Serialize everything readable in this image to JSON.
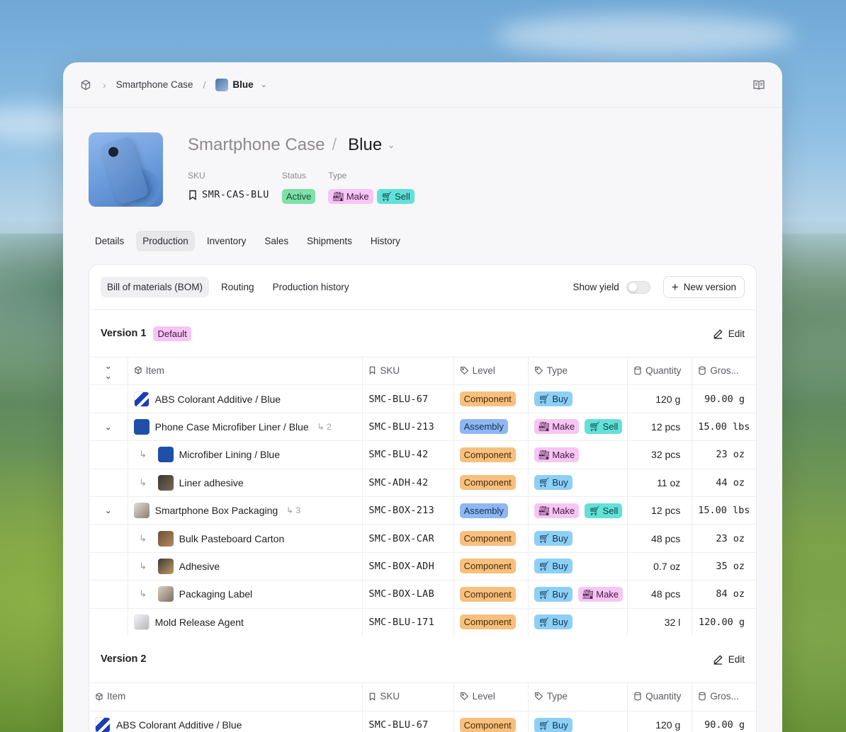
{
  "breadcrumb": {
    "parent": "Smartphone Case",
    "current": "Blue"
  },
  "product": {
    "name": "Smartphone Case",
    "variant": "Blue",
    "sku_label": "SKU",
    "sku": "SMR-CAS-BLU",
    "status_label": "Status",
    "status": "Active",
    "type_label": "Type",
    "types": [
      "Make",
      "Sell"
    ]
  },
  "tabs": [
    "Details",
    "Production",
    "Inventory",
    "Sales",
    "Shipments",
    "History"
  ],
  "active_tab": "Production",
  "subtabs": [
    "Bill of materials (BOM)",
    "Routing",
    "Production history"
  ],
  "show_yield_label": "Show yield",
  "new_version_label": "New version",
  "edit_label": "Edit",
  "columns": [
    "Item",
    "SKU",
    "Level",
    "Type",
    "Quantity",
    "Gros..."
  ],
  "versions": [
    {
      "name": "Version 1",
      "badge": "Default",
      "rows": [
        {
          "item": "ABS Colorant Additive / Blue",
          "sku": "SMC-BLU-67",
          "level": "Component",
          "types": [
            "Buy"
          ],
          "qty": "120 g",
          "gross": "90.00 g"
        },
        {
          "item": "Phone Case Microfiber Liner / Blue",
          "sub_count": "2",
          "sku": "SMC-BLU-213",
          "level": "Assembly",
          "types": [
            "Make",
            "Sell"
          ],
          "qty": "12 pcs",
          "gross": "15.00 lbs"
        },
        {
          "item": "Microfiber Lining / Blue",
          "sku": "SMC-BLU-42",
          "level": "Component",
          "types": [
            "Make"
          ],
          "qty": "32 pcs",
          "gross": "23 oz"
        },
        {
          "item": "Liner adhesive",
          "sku": "SMC-ADH-42",
          "level": "Component",
          "types": [
            "Buy"
          ],
          "qty": "11 oz",
          "gross": "44 oz"
        },
        {
          "item": "Smartphone Box Packaging",
          "sub_count": "3",
          "sku": "SMC-BOX-213",
          "level": "Assembly",
          "types": [
            "Make",
            "Sell"
          ],
          "qty": "12 pcs",
          "gross": "15.00 lbs"
        },
        {
          "item": "Bulk Pasteboard Carton",
          "sku": "SMC-BOX-CAR",
          "level": "Component",
          "types": [
            "Buy"
          ],
          "qty": "48 pcs",
          "gross": "23 oz"
        },
        {
          "item": "Adhesive",
          "sku": "SMC-BOX-ADH",
          "level": "Component",
          "types": [
            "Buy"
          ],
          "qty": "0.7 oz",
          "gross": "35 oz"
        },
        {
          "item": "Packaging Label",
          "sku": "SMC-BOX-LAB",
          "level": "Component",
          "types": [
            "Buy",
            "Make"
          ],
          "qty": "48 pcs",
          "gross": "84 oz"
        },
        {
          "item": "Mold Release Agent",
          "sku": "SMC-BLU-171",
          "level": "Component",
          "types": [
            "Buy"
          ],
          "qty": "32 l",
          "gross": "120.00 g"
        }
      ]
    },
    {
      "name": "Version 2",
      "rows": [
        {
          "item": "ABS Colorant Additive / Blue",
          "sku": "SMC-BLU-67",
          "level": "Component",
          "types": [
            "Buy"
          ],
          "qty": "120 g",
          "gross": "90.00 g"
        }
      ]
    }
  ]
}
